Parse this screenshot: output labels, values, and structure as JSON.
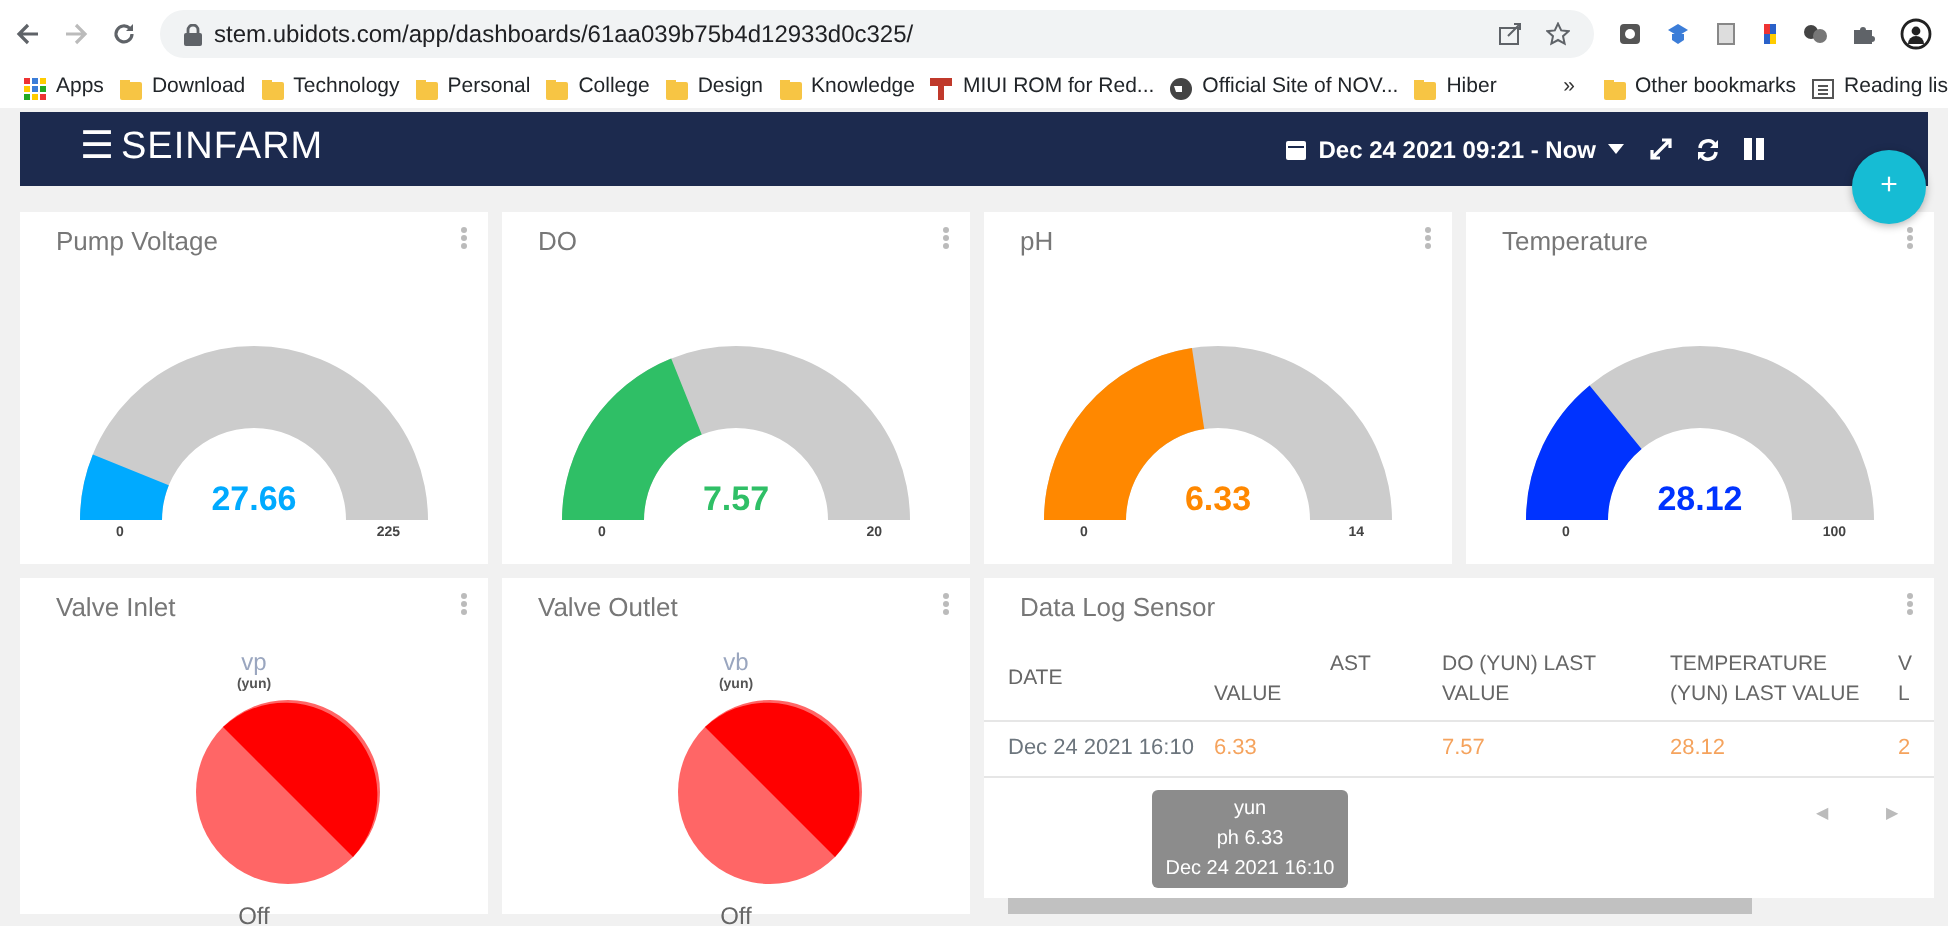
{
  "browser": {
    "url": "stem.ubidots.com/app/dashboards/61aa039b75b4d12933d0c325/",
    "bookmarks": [
      {
        "kind": "apps",
        "label": "Apps"
      },
      {
        "kind": "folder",
        "label": "Download"
      },
      {
        "kind": "folder",
        "label": "Technology"
      },
      {
        "kind": "folder",
        "label": "Personal"
      },
      {
        "kind": "folder",
        "label": "College"
      },
      {
        "kind": "folder",
        "label": "Design"
      },
      {
        "kind": "folder",
        "label": "Knowledge"
      },
      {
        "kind": "site",
        "label": "MIUI ROM for Red..."
      },
      {
        "kind": "globe",
        "label": "Official Site of NOV..."
      },
      {
        "kind": "folder",
        "label": "Hiber"
      }
    ],
    "more": "»",
    "other_bookmarks": [
      {
        "kind": "folder",
        "label": "Other bookmarks"
      },
      {
        "kind": "reading",
        "label": "Reading lis"
      }
    ]
  },
  "navbar": {
    "menu": "☰",
    "title": "SEINFARM",
    "date_range": "Dec 24 2021 09:21 - Now",
    "fab": "+"
  },
  "gauges": [
    {
      "title": "Pump Voltage",
      "value": "27.66",
      "min": "0",
      "max": "225",
      "color": "#00aaff"
    },
    {
      "title": "DO",
      "value": "7.57",
      "min": "0",
      "max": "20",
      "color": "#2fbf66"
    },
    {
      "title": "pH",
      "value": "6.33",
      "min": "0",
      "max": "14",
      "color": "#ff8800"
    },
    {
      "title": "Temperature",
      "value": "28.12",
      "min": "0",
      "max": "100",
      "color": "#0033ff"
    }
  ],
  "indicators": [
    {
      "title": "Valve Inlet",
      "variable": "vp",
      "device": "(yun)",
      "on": false,
      "state": "Off"
    },
    {
      "title": "Valve Outlet",
      "variable": "vb",
      "device": "(yun)",
      "on": false,
      "state": "Off"
    }
  ],
  "table": {
    "title": "Data Log Sensor",
    "columns": [
      {
        "lines": [
          "DATE"
        ],
        "covered": false
      },
      {
        "lines": [
          "AST",
          "VALUE"
        ],
        "covered": true
      },
      {
        "lines": [
          "DO (YUN) LAST",
          "VALUE"
        ],
        "covered": false
      },
      {
        "lines": [
          "TEMPERATURE",
          "(YUN) LAST VALUE"
        ],
        "covered": false
      },
      {
        "lines": [
          "V",
          "L"
        ],
        "covered": false
      }
    ],
    "rows": [
      [
        "Dec 24 2021 16:10",
        "6.33",
        "7.57",
        "28.12",
        "2"
      ]
    ],
    "pager": [
      "◀",
      "▶"
    ],
    "tooltip": [
      "yun",
      "ph 6.33",
      "Dec 24 2021 16:10"
    ]
  }
}
